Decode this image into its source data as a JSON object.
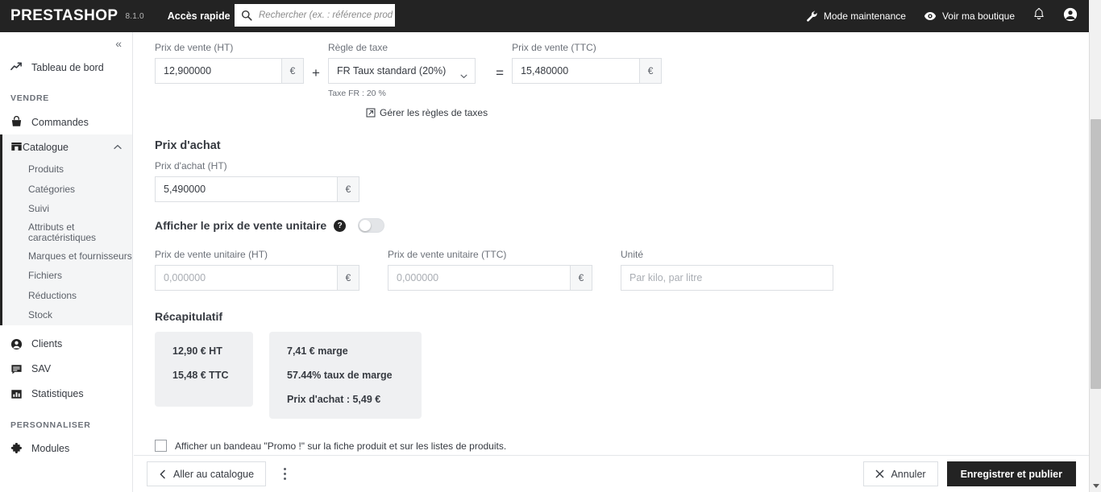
{
  "header": {
    "brand": "PRESTASHOP",
    "version": "8.1.0",
    "quick_access_label": "Accès rapide",
    "search_placeholder": "Rechercher (ex. : référence produit, n",
    "search_value": "",
    "search_icon": "search-icon",
    "maintenance_label": "Mode maintenance",
    "maintenance_icon": "wrench-icon",
    "view_shop_label": "Voir ma boutique",
    "view_shop_icon": "eye-icon",
    "notifications_icon": "bell-icon",
    "account_icon": "user-avatar-icon"
  },
  "sidebar": {
    "collapse_label": "«",
    "dashboard": {
      "label": "Tableau de bord",
      "icon": "trend-line-icon"
    },
    "section_sell": "VENDRE",
    "orders": {
      "label": "Commandes",
      "icon": "shopping-basket-icon"
    },
    "catalog": {
      "label": "Catalogue",
      "icon": "store-icon",
      "chevron": "˄"
    },
    "catalog_children": [
      {
        "label": "Produits"
      },
      {
        "label": "Catégories"
      },
      {
        "label": "Suivi"
      },
      {
        "label": "Attributs et",
        "label2": "caractéristiques"
      },
      {
        "label": "Marques et fournisseurs"
      },
      {
        "label": "Fichiers"
      },
      {
        "label": "Réductions"
      },
      {
        "label": "Stock"
      }
    ],
    "customers": {
      "label": "Clients",
      "icon": "person-circle-icon"
    },
    "sav": {
      "label": "SAV",
      "icon": "message-lines-icon"
    },
    "stats": {
      "label": "Statistiques",
      "icon": "bar-chart-icon"
    },
    "section_customize": "PERSONNALISER",
    "modules": {
      "label": "Modules",
      "icon": "puzzle-piece-icon"
    }
  },
  "pricing": {
    "retail_ht_label": "Prix de vente (HT)",
    "retail_ht_value": "12,900000",
    "currency_symbol": "€",
    "plus_sign": "+",
    "equals_sign": "=",
    "tax_rule_label": "Règle de taxe",
    "tax_rule_selected": "FR Taux standard (20%)",
    "tax_rule_options": [
      "FR Taux standard (20%)"
    ],
    "tax_note": "Taxe  FR : 20 %",
    "retail_ttc_label": "Prix de vente (TTC)",
    "retail_ttc_value": "15,480000",
    "manage_tax_link": "Gérer les règles de taxes",
    "manage_tax_icon": "external-link-icon"
  },
  "purchase": {
    "section_title": "Prix d'achat",
    "label": "Prix d'achat (HT)",
    "value": "5,490000",
    "currency_symbol": "€"
  },
  "unit_price": {
    "toggle_title": "Afficher le prix de vente unitaire",
    "help_icon": "question-mark-icon",
    "help_glyph": "?",
    "toggle_state": "off",
    "ht_label": "Prix de vente unitaire (HT)",
    "ht_value": "",
    "ht_placeholder": "0,000000",
    "ttc_label": "Prix de vente unitaire (TTC)",
    "ttc_value": "",
    "ttc_placeholder": "0,000000",
    "unit_label": "Unité",
    "unit_value": "",
    "unit_placeholder": "Par kilo, par litre",
    "currency_symbol": "€"
  },
  "summary": {
    "title": "Récapitulatif",
    "card_left": [
      "12,90 € HT",
      "15,48 € TTC"
    ],
    "card_right": [
      "7,41 € marge",
      "57.44% taux de marge",
      "Prix d'achat : 5,49 €"
    ]
  },
  "promo": {
    "checked": false,
    "label": "Afficher un bandeau \"Promo !\" sur la fiche produit et sur les listes de produits."
  },
  "footer": {
    "back_label": "Aller au catalogue",
    "back_icon": "chevron-left-icon",
    "kebab_icon": "more-vertical-icon",
    "cancel_label": "Annuler",
    "cancel_icon": "close-x-icon",
    "save_label": "Enregistrer et publier"
  },
  "colors": {
    "header_bg": "#232323",
    "primary_button": "#232323",
    "card_bg": "#eff0f2",
    "active_nav_bg": "#f4f5f6",
    "border": "#dcdfe3",
    "muted_text": "#6c7179"
  }
}
